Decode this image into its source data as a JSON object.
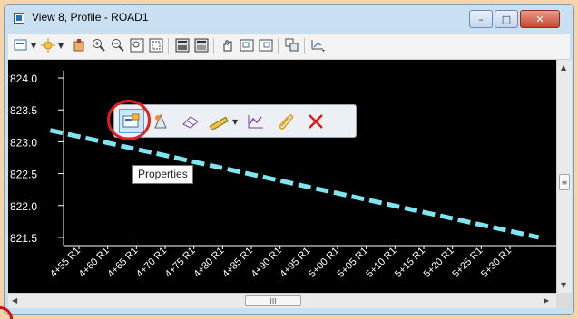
{
  "window": {
    "title": "View 8, Profile - ROAD1",
    "controls": {
      "minimize": "–",
      "maximize": "□",
      "close": "✕"
    }
  },
  "toolbar": {
    "icons": [
      "view-attributes-icon",
      "display-style-icon",
      "level-display-icon",
      "zoom-in-icon",
      "zoom-out-icon",
      "fit-view-icon",
      "window-area-icon",
      "calculator-icon",
      "calculator-alt-icon",
      "pan-icon",
      "previous-view-icon",
      "next-view-icon",
      "view-copy-icon",
      "view-tools-icon"
    ]
  },
  "popup_toolbar": {
    "icons": [
      "properties-icon",
      "edit-tool-icon",
      "eraser-icon",
      "measure-icon",
      "profile-graph-icon",
      "paperclip-icon",
      "delete-icon"
    ]
  },
  "tooltip": {
    "text": "Properties"
  },
  "chart_data": {
    "type": "line",
    "y_ticks": [
      "824.0",
      "823.5",
      "823.0",
      "822.5",
      "822.0",
      "821.5"
    ],
    "x_ticks": [
      "4+55 R1",
      "4+60 R1",
      "4+65 R1",
      "4+70 R1",
      "4+75 R1",
      "4+80 R1",
      "4+85 R1",
      "4+90 R1",
      "4+95 R1",
      "5+00 R1",
      "5+05 R1",
      "5+10 R1",
      "5+15 R1",
      "5+20 R1",
      "5+25 R1",
      "5+30 R1"
    ],
    "ylim": [
      821.3,
      824.1
    ],
    "series": [
      {
        "station": [
          4.5,
          5.35
        ],
        "elevation": [
          823.18,
          821.5
        ]
      }
    ],
    "colors": {
      "line": "#7fe5f0",
      "axis": "#ffffff",
      "label": "#ffffff",
      "background": "#000000"
    }
  },
  "scroll": {
    "h_thumb": "III"
  }
}
